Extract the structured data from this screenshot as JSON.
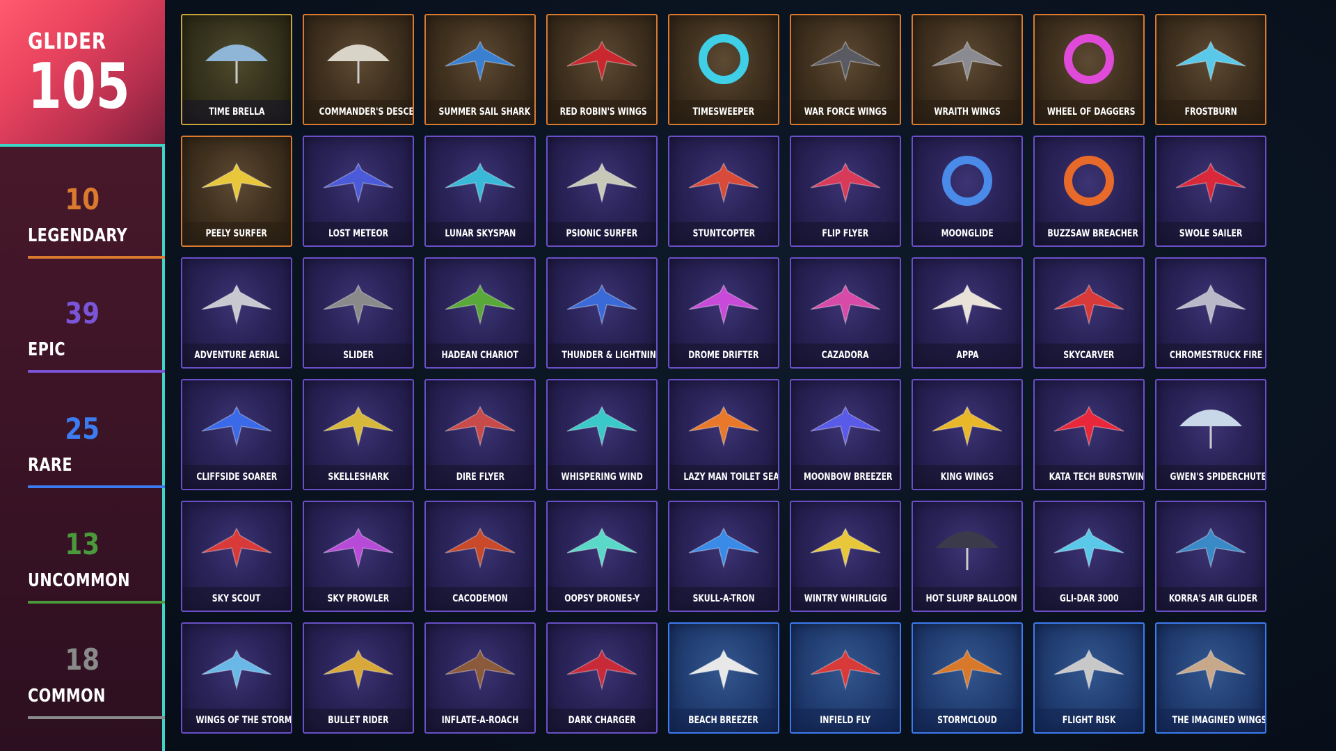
{
  "header": {
    "category": "GLIDER",
    "total": "105"
  },
  "rarities": [
    {
      "key": "legendary",
      "count": "10",
      "label": "LEGENDARY",
      "color": "#d97a2f"
    },
    {
      "key": "epic",
      "count": "39",
      "label": "EPIC",
      "color": "#7a55d8"
    },
    {
      "key": "rare",
      "count": "25",
      "label": "RARE",
      "color": "#3d7bf0"
    },
    {
      "key": "uncommon",
      "count": "13",
      "label": "UNCOMMON",
      "color": "#4a9a3c"
    },
    {
      "key": "common",
      "count": "18",
      "label": "COMMON",
      "color": "#8a8a8a"
    }
  ],
  "items": [
    {
      "name": "TIME BRELLA",
      "rarity": "uncommon",
      "icon": "umbrella-icon",
      "color": "#8fb6d6"
    },
    {
      "name": "COMMANDER'S DESCENT",
      "rarity": "legendary",
      "icon": "parachute-stack-icon",
      "color": "#d8d4c8"
    },
    {
      "name": "SUMMER SAIL SHARK",
      "rarity": "legendary",
      "icon": "shark-glider-icon",
      "color": "#3a7fd0"
    },
    {
      "name": "RED ROBIN'S WINGS",
      "rarity": "legendary",
      "icon": "red-wings-icon",
      "color": "#c8282e"
    },
    {
      "name": "TIMESWEEPER",
      "rarity": "legendary",
      "icon": "portal-ring-icon",
      "color": "#3fd0e8"
    },
    {
      "name": "WAR FORCE WINGS",
      "rarity": "legendary",
      "icon": "dark-wings-icon",
      "color": "#5a5a62"
    },
    {
      "name": "WRAITH WINGS",
      "rarity": "legendary",
      "icon": "bat-wings-icon",
      "color": "#8a8a90"
    },
    {
      "name": "WHEEL OF DAGGERS",
      "rarity": "legendary",
      "icon": "dagger-wheel-icon",
      "color": "#e04ad8"
    },
    {
      "name": "FROSTBURN",
      "rarity": "legendary",
      "icon": "ice-glider-icon",
      "color": "#5ac8e8"
    },
    {
      "name": "PEELY SURFER",
      "rarity": "legendary",
      "icon": "banana-board-icon",
      "color": "#e8c83a"
    },
    {
      "name": "LOST METEOR",
      "rarity": "epic",
      "icon": "meteor-icon",
      "color": "#4a5ad8"
    },
    {
      "name": "LUNAR SKYSPAN",
      "rarity": "epic",
      "icon": "lunar-glider-icon",
      "color": "#3ab8d8"
    },
    {
      "name": "PSIONIC SURFER",
      "rarity": "epic",
      "icon": "psionic-glider-icon",
      "color": "#c8c8b8"
    },
    {
      "name": "STUNTCOPTER",
      "rarity": "epic",
      "icon": "copter-icon",
      "color": "#d84a3a"
    },
    {
      "name": "FLIP FLYER",
      "rarity": "epic",
      "icon": "flip-glider-icon",
      "color": "#d83a5a"
    },
    {
      "name": "MOONGLIDE",
      "rarity": "epic",
      "icon": "crescent-icon",
      "color": "#4a8ae8"
    },
    {
      "name": "BUZZSAW BREACHER",
      "rarity": "epic",
      "icon": "buzzsaw-icon",
      "color": "#e86a2a"
    },
    {
      "name": "SWOLE SAILER",
      "rarity": "epic",
      "icon": "red-fish-icon",
      "color": "#d8283a"
    },
    {
      "name": "ADVENTURE AERIAL",
      "rarity": "epic",
      "icon": "silver-wings-icon",
      "color": "#c8c8d0"
    },
    {
      "name": "SLIDER",
      "rarity": "epic",
      "icon": "slider-glider-icon",
      "color": "#8a8a8a"
    },
    {
      "name": "HADEAN CHARIOT",
      "rarity": "epic",
      "icon": "chariot-icon",
      "color": "#5aa83a"
    },
    {
      "name": "THUNDER & LIGHTNING",
      "rarity": "epic",
      "icon": "lightning-glider-icon",
      "color": "#3a6ad8"
    },
    {
      "name": "DROME DRIFTER",
      "rarity": "epic",
      "icon": "drome-icon",
      "color": "#c84ad8"
    },
    {
      "name": "CAZADORA",
      "rarity": "epic",
      "icon": "cazadora-wings-icon",
      "color": "#d84aa8"
    },
    {
      "name": "APPA",
      "rarity": "epic",
      "icon": "sky-bison-icon",
      "color": "#e8e2d8"
    },
    {
      "name": "SKYCARVER",
      "rarity": "epic",
      "icon": "skycarver-icon",
      "color": "#d83a3a"
    },
    {
      "name": "CHROMESTRUCK FIRE",
      "rarity": "epic",
      "icon": "chrome-wings-icon",
      "color": "#b8b8c8"
    },
    {
      "name": "CLIFFSIDE SOARER",
      "rarity": "epic",
      "icon": "soarer-icon",
      "color": "#3a6ae8"
    },
    {
      "name": "SKELLESHARK",
      "rarity": "epic",
      "icon": "gold-shark-icon",
      "color": "#d8b83a"
    },
    {
      "name": "DIRE FLYER",
      "rarity": "epic",
      "icon": "dire-wings-icon",
      "color": "#c84a4a"
    },
    {
      "name": "WHISPERING WIND",
      "rarity": "epic",
      "icon": "wind-spirit-icon",
      "color": "#3ac8c8"
    },
    {
      "name": "LAZY MAN TOILET SEAT",
      "rarity": "epic",
      "icon": "toilet-icon",
      "color": "#e8782a"
    },
    {
      "name": "MOONBOW BREEZER",
      "rarity": "epic",
      "icon": "moonbow-icon",
      "color": "#5a5ae8"
    },
    {
      "name": "KING WINGS",
      "rarity": "epic",
      "icon": "crown-icon",
      "color": "#e8b82a"
    },
    {
      "name": "KATA TECH BURSTWING",
      "rarity": "epic",
      "icon": "burstwing-icon",
      "color": "#e8283a"
    },
    {
      "name": "GWEN'S SPIDERCHUTE",
      "rarity": "epic",
      "icon": "spiderchute-icon",
      "color": "#c8d8e8"
    },
    {
      "name": "SKY SCOUT",
      "rarity": "epic",
      "icon": "sky-scout-icon",
      "color": "#d83a3a"
    },
    {
      "name": "SKY PROWLER",
      "rarity": "epic",
      "icon": "prowler-icon",
      "color": "#b84ad8"
    },
    {
      "name": "CACODEMON",
      "rarity": "epic",
      "icon": "demon-icon",
      "color": "#c84a2a"
    },
    {
      "name": "OOPSY DRONES-Y",
      "rarity": "epic",
      "icon": "drones-icon",
      "color": "#5ad8c8"
    },
    {
      "name": "SKULL-A-TRON",
      "rarity": "epic",
      "icon": "skull-icon",
      "color": "#3a8ae8"
    },
    {
      "name": "WINTRY WHIRLIGIG",
      "rarity": "epic",
      "icon": "whirligig-icon",
      "color": "#e8c83a"
    },
    {
      "name": "HOT SLURP BALLOON",
      "rarity": "epic",
      "icon": "balloon-icon",
      "color": "#3a3a4a"
    },
    {
      "name": "GLI-DAR 3000",
      "rarity": "epic",
      "icon": "glidar-icon",
      "color": "#5ac8e8"
    },
    {
      "name": "KORRA'S AIR GLIDER",
      "rarity": "epic",
      "icon": "air-glider-icon",
      "color": "#3a8ac8"
    },
    {
      "name": "WINGS OF THE STORM",
      "rarity": "epic",
      "icon": "storm-wings-icon",
      "color": "#6ab8e8"
    },
    {
      "name": "BULLET RIDER",
      "rarity": "epic",
      "icon": "bullet-icon",
      "color": "#d8a83a"
    },
    {
      "name": "INFLATE-A-ROACH",
      "rarity": "epic",
      "icon": "roach-icon",
      "color": "#8a5a3a"
    },
    {
      "name": "DARK CHARGER",
      "rarity": "epic",
      "icon": "charger-icon",
      "color": "#c82a3a"
    },
    {
      "name": "BEACH BREEZER",
      "rarity": "rare",
      "icon": "beach-glider-icon",
      "color": "#e8e8e8"
    },
    {
      "name": "INFIELD FLY",
      "rarity": "rare",
      "icon": "baseball-glider-icon",
      "color": "#d83a3a"
    },
    {
      "name": "STORMCLOUD",
      "rarity": "rare",
      "icon": "stormcloud-icon",
      "color": "#d8782a"
    },
    {
      "name": "FLIGHT RISK",
      "rarity": "rare",
      "icon": "hang-glider-icon",
      "color": "#c8c8c8"
    },
    {
      "name": "THE IMAGINED WINGSPAN",
      "rarity": "rare",
      "icon": "imagined-wings-icon",
      "color": "#c8a88a"
    }
  ]
}
